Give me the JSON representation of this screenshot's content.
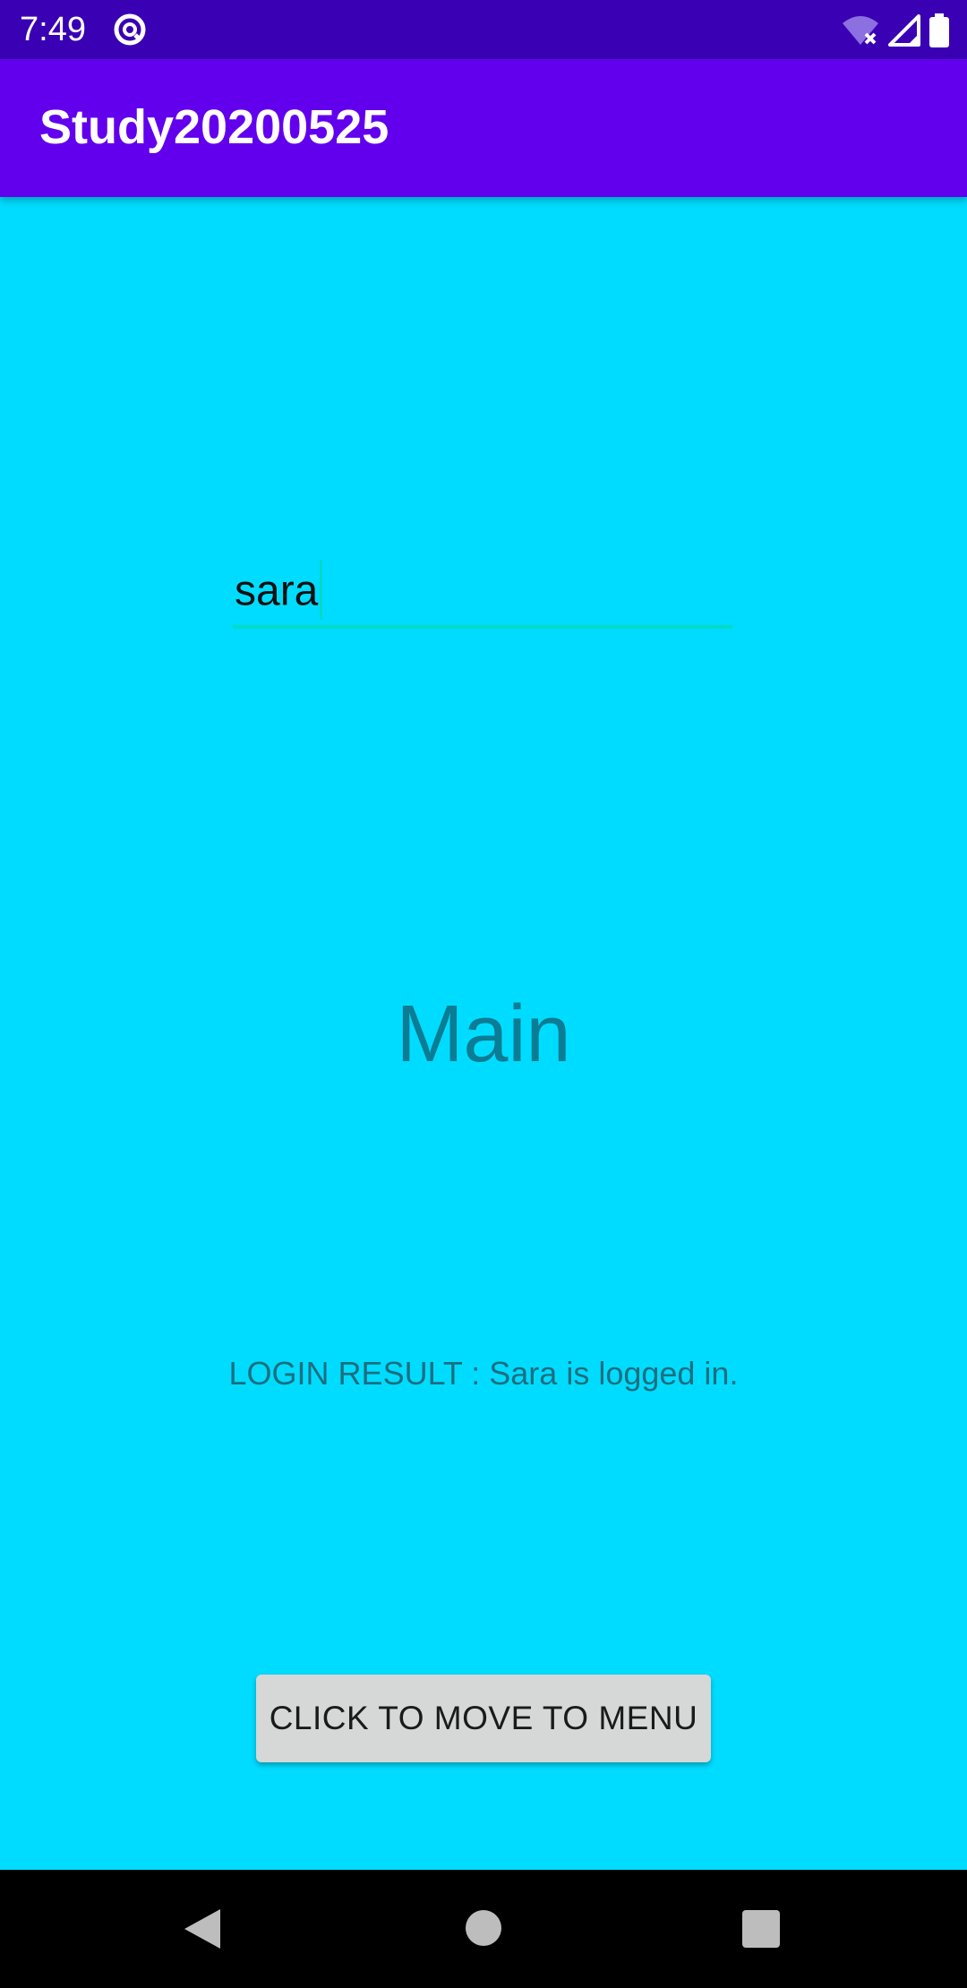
{
  "status_bar": {
    "time": "7:49",
    "icons": [
      "at-sign-icon",
      "wifi-off-icon",
      "cell-signal-icon",
      "battery-icon"
    ]
  },
  "app_bar": {
    "title": "Study20200525",
    "color": "#6200EE"
  },
  "name_input": {
    "value": "sara",
    "accent_color": "#03DAC5"
  },
  "main_heading": "Main",
  "login_result": "LOGIN RESULT : Sara is logged in.",
  "menu_button": {
    "label": "CLICK TO MOVE TO MENU"
  },
  "nav_bar": {
    "buttons": [
      "back-icon",
      "home-icon",
      "recents-icon"
    ]
  },
  "colors": {
    "background": "#00DCFF",
    "status_bar": "#3A00B3",
    "heading_text": "#0A7C93"
  }
}
